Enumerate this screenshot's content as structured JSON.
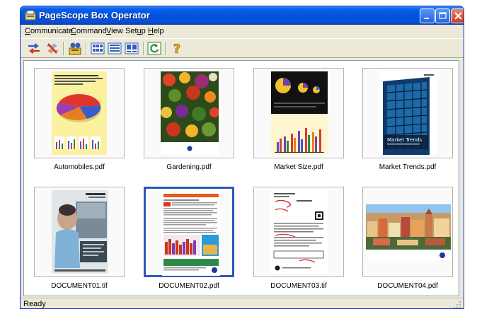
{
  "window": {
    "title": "PageScope Box Operator",
    "icon": "app-icon"
  },
  "menu": {
    "items": [
      {
        "label": "Communicate",
        "accel": "C"
      },
      {
        "label": "Command",
        "accel": "C"
      },
      {
        "label": "View",
        "accel": "V"
      },
      {
        "label": "Setup",
        "accel": "u"
      },
      {
        "label": "Help",
        "accel": "H"
      }
    ]
  },
  "toolbar": {
    "buttons": [
      {
        "name": "connect-icon"
      },
      {
        "name": "disconnect-icon"
      },
      {
        "name": "box-login-icon"
      },
      {
        "name": "large-icons-view-icon"
      },
      {
        "name": "details-view-icon"
      },
      {
        "name": "thumbnail-view-icon"
      },
      {
        "name": "refresh-icon"
      },
      {
        "name": "help-icon"
      }
    ]
  },
  "files": [
    {
      "name": "Automobiles.pdf",
      "selected": false
    },
    {
      "name": "Gardening.pdf",
      "selected": false
    },
    {
      "name": "Market Size.pdf",
      "selected": false
    },
    {
      "name": "Market Trends.pdf",
      "selected": false
    },
    {
      "name": "DOCUMENT01.tif",
      "selected": false
    },
    {
      "name": "DOCUMENT02.pdf",
      "selected": true
    },
    {
      "name": "DOCUMENT03.tif",
      "selected": false
    },
    {
      "name": "DOCUMENT04.pdf",
      "selected": false
    }
  ],
  "thumbnails": {
    "market_trends": {
      "heading": "Market Trends"
    }
  },
  "status": {
    "text": "Ready"
  },
  "colors": {
    "titlebar": "#0053e0",
    "selection": "#2e59b8",
    "chrome": "#ece9d8"
  }
}
